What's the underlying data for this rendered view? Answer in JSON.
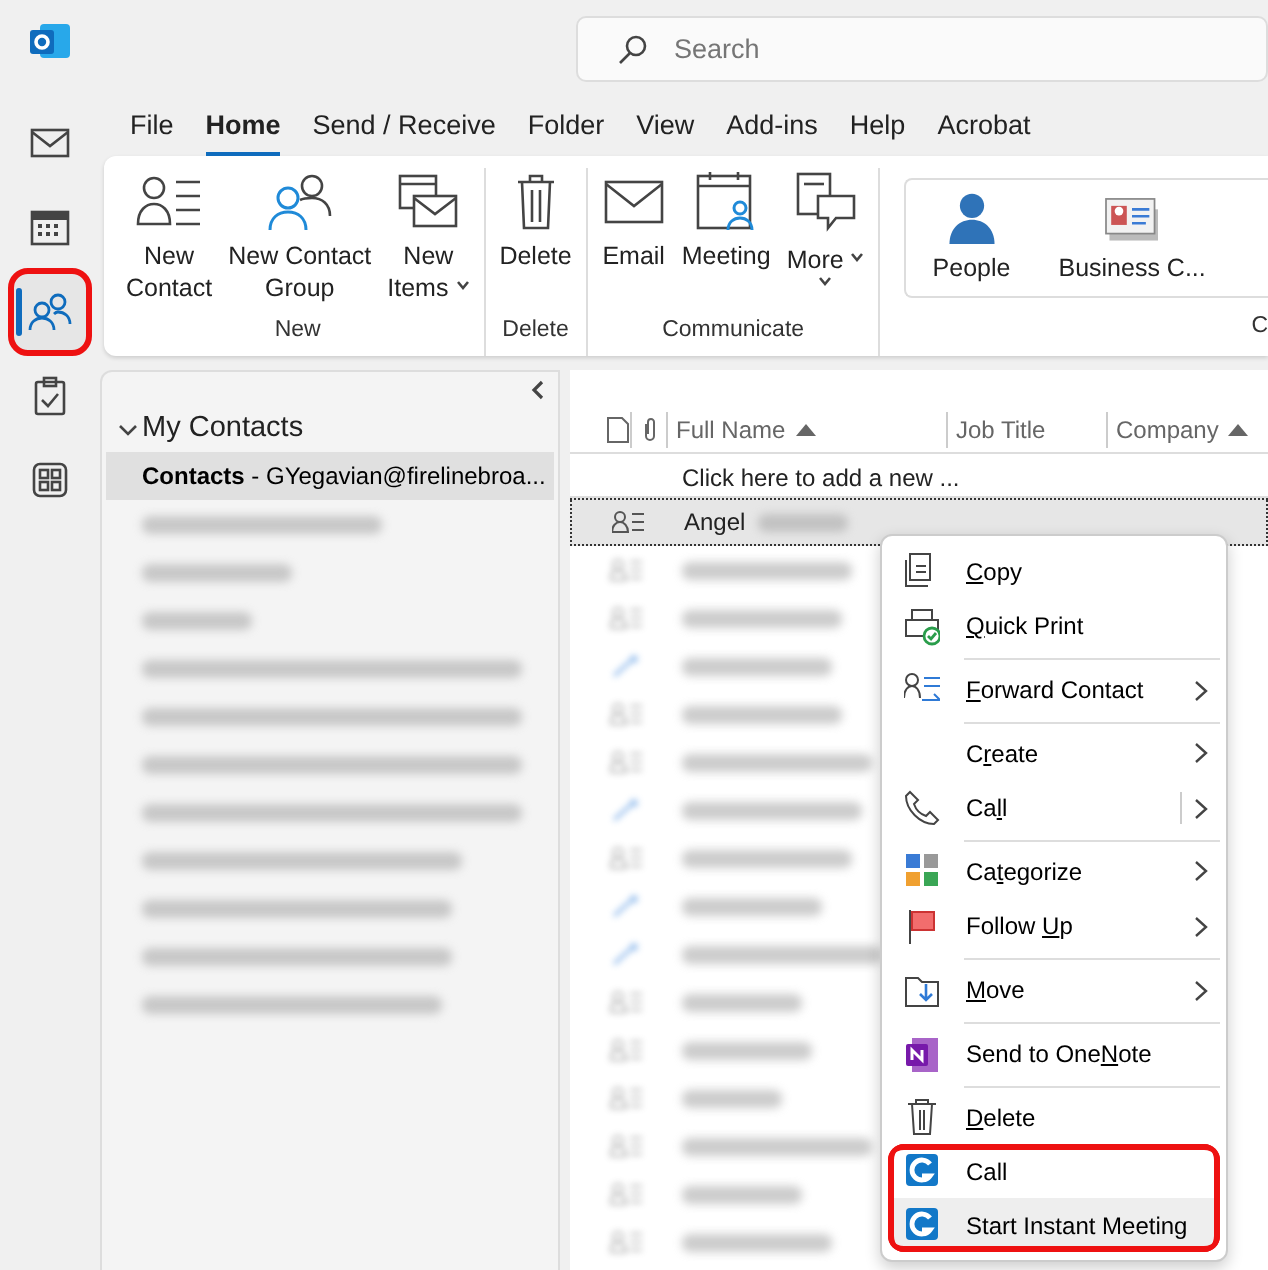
{
  "rail": {
    "items": [
      {
        "kind": "mail",
        "selected": false,
        "annotated": false
      },
      {
        "kind": "calendar",
        "selected": false,
        "annotated": false
      },
      {
        "kind": "people",
        "selected": true,
        "annotated": true
      },
      {
        "kind": "tasks",
        "selected": false,
        "annotated": false
      },
      {
        "kind": "apps",
        "selected": false,
        "annotated": false
      }
    ]
  },
  "search": {
    "placeholder": "Search"
  },
  "tabs": [
    {
      "label": "File",
      "selected": false
    },
    {
      "label": "Home",
      "selected": true
    },
    {
      "label": "Send / Receive",
      "selected": false
    },
    {
      "label": "Folder",
      "selected": false
    },
    {
      "label": "View",
      "selected": false
    },
    {
      "label": "Add-ins",
      "selected": false
    },
    {
      "label": "Help",
      "selected": false
    },
    {
      "label": "Acrobat",
      "selected": false
    }
  ],
  "ribbon": {
    "groups": [
      {
        "label": "New",
        "buttons": [
          {
            "kind": "contact",
            "lines": [
              "New",
              "Contact"
            ],
            "dropdown": false
          },
          {
            "kind": "group",
            "lines": [
              "New Contact",
              "Group"
            ],
            "dropdown": false
          },
          {
            "kind": "items",
            "lines": [
              "New",
              "Items"
            ],
            "dropdown": true
          }
        ]
      },
      {
        "label": "Delete",
        "buttons": [
          {
            "kind": "trash",
            "lines": [
              "Delete"
            ],
            "dropdown": false
          }
        ]
      },
      {
        "label": "Communicate",
        "buttons": [
          {
            "kind": "email",
            "lines": [
              "Email"
            ],
            "dropdown": false
          },
          {
            "kind": "meeting",
            "lines": [
              "Meeting"
            ],
            "dropdown": false
          },
          {
            "kind": "more",
            "lines": [
              "More"
            ],
            "dropdown": true
          }
        ]
      }
    ],
    "gallery": {
      "items": [
        {
          "kind": "person",
          "label": "People"
        },
        {
          "kind": "card",
          "label": "Business C..."
        }
      ],
      "group_label": "C"
    }
  },
  "folders": {
    "title": "My Contacts",
    "expanded": true,
    "items": [
      {
        "kind": "text",
        "text": "**Contacts** - GYegavian@firelinebroa...",
        "selected": true
      },
      {
        "kind": "blurred",
        "selected": false
      },
      {
        "kind": "blurred",
        "selected": false
      },
      {
        "kind": "blurred",
        "selected": false
      },
      {
        "kind": "blurred",
        "selected": false
      },
      {
        "kind": "blurred",
        "selected": false
      },
      {
        "kind": "blurred",
        "selected": false
      },
      {
        "kind": "blurred",
        "selected": false
      },
      {
        "kind": "blurred",
        "selected": false
      },
      {
        "kind": "blurred",
        "selected": false
      },
      {
        "kind": "blurred",
        "selected": false
      },
      {
        "kind": "blurred",
        "selected": false
      }
    ]
  },
  "table": {
    "columns": [
      {
        "kind": "icon"
      },
      {
        "kind": "attach"
      },
      {
        "kind": "text",
        "label": "Full Name",
        "sorted": true
      },
      {
        "kind": "text",
        "label": "Job Title",
        "sorted": false
      },
      {
        "kind": "text",
        "label": "Company",
        "sorted": true
      }
    ],
    "add_row": "Click here to add a new ...",
    "rows": [
      {
        "kind": "contact",
        "name": "Angel",
        "selected": true
      },
      {
        "kind": "blurred",
        "selected": false
      },
      {
        "kind": "blurred",
        "selected": false
      },
      {
        "kind": "blurred-link",
        "selected": false
      },
      {
        "kind": "blurred",
        "selected": false
      },
      {
        "kind": "blurred",
        "selected": false
      },
      {
        "kind": "blurred-link",
        "selected": false
      },
      {
        "kind": "blurred",
        "selected": false
      },
      {
        "kind": "blurred-link",
        "selected": false
      },
      {
        "kind": "blurred-link",
        "selected": false
      },
      {
        "kind": "blurred",
        "selected": false
      },
      {
        "kind": "blurred",
        "selected": false
      },
      {
        "kind": "blurred",
        "selected": false
      },
      {
        "kind": "blurred",
        "selected": false
      },
      {
        "kind": "blurred",
        "selected": false
      },
      {
        "kind": "blurred",
        "selected": false
      }
    ]
  },
  "context_menu": {
    "items": [
      {
        "kind": "copy",
        "label": {
          "key": "C",
          "after": "opy"
        },
        "submenu": false,
        "split": false,
        "separator_after": false,
        "annotated": false,
        "selected": false
      },
      {
        "kind": "print",
        "label": {
          "key": "Q",
          "after": "uick Print"
        },
        "submenu": false,
        "split": false,
        "separator_after": true,
        "annotated": false,
        "selected": false
      },
      {
        "kind": "forward",
        "label": {
          "key": "F",
          "after": "orward Contact"
        },
        "submenu": true,
        "split": false,
        "separator_after": true,
        "annotated": false,
        "selected": false
      },
      {
        "kind": "plain",
        "label": {
          "before": "C",
          "key": "r",
          "after": "eate"
        },
        "submenu": true,
        "split": false,
        "separator_after": false,
        "annotated": false,
        "selected": false
      },
      {
        "kind": "phone",
        "label": {
          "before": "Ca",
          "key": "l",
          "after": "l"
        },
        "submenu": true,
        "split": true,
        "separator_after": true,
        "annotated": false,
        "selected": false
      },
      {
        "kind": "categorize",
        "label": {
          "before": "Ca",
          "key": "t",
          "after": "egorize"
        },
        "submenu": true,
        "split": false,
        "separator_after": false,
        "annotated": false,
        "selected": false
      },
      {
        "kind": "flag",
        "label": {
          "before": "Follow ",
          "key": "U",
          "after": "p"
        },
        "submenu": true,
        "split": false,
        "separator_after": true,
        "annotated": false,
        "selected": false
      },
      {
        "kind": "move",
        "label": {
          "key": "M",
          "after": "ove"
        },
        "submenu": true,
        "split": false,
        "separator_after": true,
        "annotated": false,
        "selected": false
      },
      {
        "kind": "onenote",
        "label": {
          "before": "Send to One",
          "key": "N",
          "after": "ote"
        },
        "submenu": false,
        "split": false,
        "separator_after": true,
        "annotated": false,
        "selected": false
      },
      {
        "kind": "trash",
        "label": {
          "key": "D",
          "after": "elete"
        },
        "submenu": false,
        "split": false,
        "separator_after": false,
        "annotated": false,
        "selected": false
      },
      {
        "kind": "app",
        "label": {
          "before": "Call"
        },
        "submenu": false,
        "split": false,
        "separator_after": false,
        "annotated": true,
        "selected": false
      },
      {
        "kind": "app",
        "label": {
          "before": "Start Instant Meeting"
        },
        "submenu": false,
        "split": false,
        "separator_after": false,
        "annotated": true,
        "selected": true
      }
    ]
  }
}
